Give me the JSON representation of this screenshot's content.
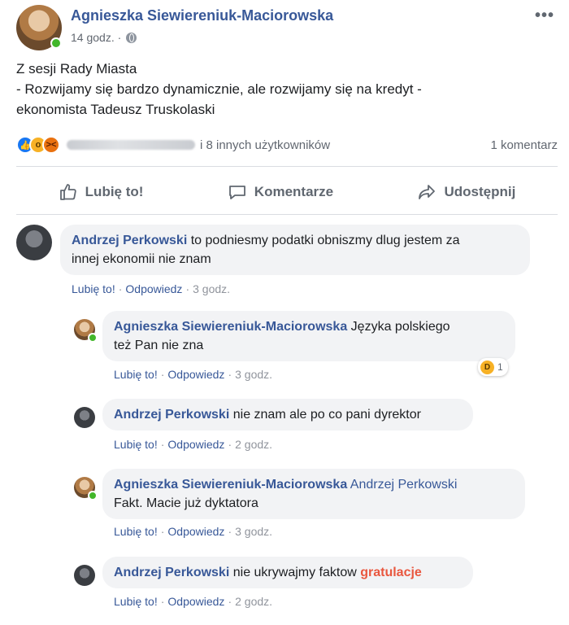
{
  "post": {
    "author": "Agnieszka Siewiereniuk-Maciorowska",
    "time": "14 godz. ·",
    "lines": [
      "Z sesji Rady Miasta",
      "- Rozwijamy się bardzo dynamicznie, ale rozwijamy się na kredyt -",
      "ekonomista Tadeusz Truskolaski"
    ],
    "reactions_others": "i 8 innych użytkowników",
    "comment_count": "1 komentarz"
  },
  "actions": {
    "like": "Lubię to!",
    "comment": "Komentarze",
    "share": "Udostępnij"
  },
  "comment_labels": {
    "like": "Lubię to!",
    "reply": "Odpowiedz",
    "sep": "·"
  },
  "comments": [
    {
      "name": "Andrzej Perkowski",
      "text": "to podniesmy podatki obniszmy dlug jestem za",
      "text2": "innej ekonomii nie znam",
      "time": "3 godz."
    },
    {
      "name": "Agnieszka Siewiereniuk-Maciorowska",
      "text": "Języka polskiego",
      "text2": "też Pan nie zna",
      "time": "3 godz.",
      "reaction_count": "1"
    },
    {
      "name": "Andrzej Perkowski",
      "text": "nie znam ale po co pani dyrektor",
      "time": "2 godz."
    },
    {
      "name": "Agnieszka Siewiereniuk-Maciorowska",
      "mention": "Andrzej Perkowski",
      "text2": "Fakt. Macie już dyktatora",
      "time": "3 godz."
    },
    {
      "name": "Andrzej Perkowski",
      "text": "nie ukrywajmy faktow",
      "highlight": "gratulacje",
      "time": "2 godz."
    }
  ],
  "colors": {
    "link": "#385898",
    "online": "#42b72a",
    "highlight": "#e9573f"
  },
  "icons": [
    "globe-icon",
    "more-icon",
    "like-icon",
    "comment-icon",
    "share-icon",
    "haha-icon"
  ]
}
